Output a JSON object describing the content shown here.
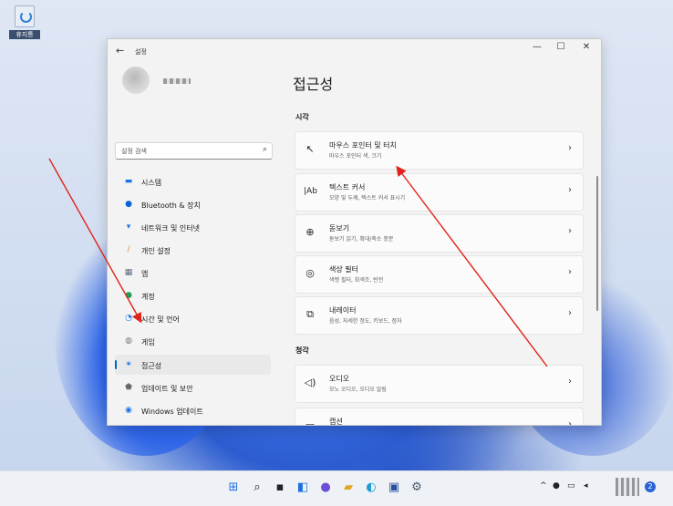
{
  "desktop": {
    "recycle_bin_label": "휴지통"
  },
  "window": {
    "title": "설정",
    "controls": {
      "minimize": "—",
      "maximize": "☐",
      "close": "✕"
    }
  },
  "sidebar": {
    "search_placeholder": "설정 검색",
    "items": [
      {
        "label": "시스템",
        "icon": "monitor-icon",
        "color": "#1a73e8"
      },
      {
        "label": "Bluetooth & 장치",
        "icon": "bluetooth-icon",
        "color": "#0a64d6"
      },
      {
        "label": "네트워크 및 인터넷",
        "icon": "wifi-icon",
        "color": "#1a73e8"
      },
      {
        "label": "개인 설정",
        "icon": "brush-icon",
        "color": "#d98a2b"
      },
      {
        "label": "앱",
        "icon": "apps-icon",
        "color": "#5c6b80"
      },
      {
        "label": "계정",
        "icon": "account-icon",
        "color": "#1e9e5a"
      },
      {
        "label": "시간 및 언어",
        "icon": "globe-clock-icon",
        "color": "#1a73e8"
      },
      {
        "label": "게임",
        "icon": "gamepad-icon",
        "color": "#7a7a7a"
      },
      {
        "label": "접근성",
        "icon": "accessibility-icon",
        "color": "#1a73e8"
      },
      {
        "label": "업데이트 및 보안",
        "icon": "shield-icon",
        "color": "#6a6a6a"
      },
      {
        "label": "Windows 업데이트",
        "icon": "update-icon",
        "color": "#1a73e8"
      }
    ]
  },
  "main": {
    "page_title": "접근성",
    "sections": [
      {
        "heading": "시각"
      },
      {
        "heading": "청각"
      }
    ],
    "cards": [
      {
        "title": "마우스 포인터 및 터치",
        "subtitle": "마우스 포인터 색, 크기",
        "icon": "pointer-icon"
      },
      {
        "title": "텍스트 커서",
        "subtitle": "모양 및 두께, 텍스트 커서 표시기",
        "icon": "text-cursor-icon"
      },
      {
        "title": "돋보기",
        "subtitle": "돋보기 읽기, 확대/축소 증분",
        "icon": "magnifier-icon"
      },
      {
        "title": "색상 필터",
        "subtitle": "색맹 필터, 회색조, 반전",
        "icon": "palette-icon"
      },
      {
        "title": "내레이터",
        "subtitle": "음성, 자세한 정도, 키보드, 점자",
        "icon": "narrator-icon"
      },
      {
        "title": "오디오",
        "subtitle": "모노 오디오, 오디오 알림",
        "icon": "speaker-icon"
      },
      {
        "title": "캡션",
        "subtitle": "",
        "icon": "captions-icon"
      }
    ],
    "chevron": "›"
  },
  "taskbar": {
    "apps": [
      "start-icon",
      "search-icon",
      "task-view-icon",
      "widgets-icon",
      "chat-icon",
      "file-explorer-icon",
      "edge-icon",
      "store-icon",
      "settings-icon"
    ],
    "notification_count": "2"
  },
  "annotations": {
    "arrow_color": "#e0241b"
  }
}
